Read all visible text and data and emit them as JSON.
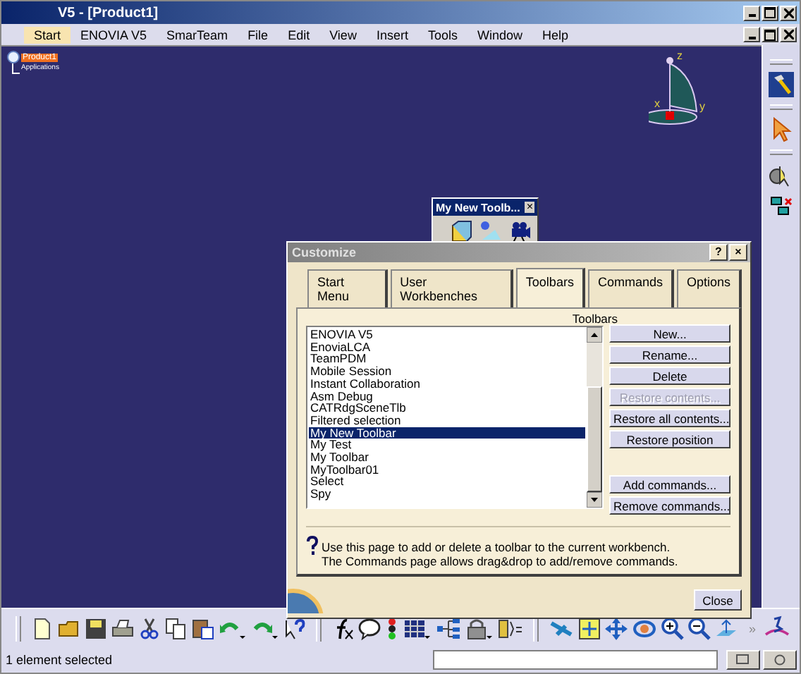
{
  "window": {
    "title": "V5 - [Product1]"
  },
  "menu": [
    {
      "label": "Start",
      "selected": true
    },
    {
      "label": "ENOVIA V5",
      "selected": false
    },
    {
      "label": "SmarTeam",
      "selected": false
    },
    {
      "label": "File",
      "selected": false
    },
    {
      "label": "Edit",
      "selected": false
    },
    {
      "label": "View",
      "selected": false
    },
    {
      "label": "Insert",
      "selected": false
    },
    {
      "label": "Tools",
      "selected": false
    },
    {
      "label": "Window",
      "selected": false
    },
    {
      "label": "Help",
      "selected": false
    }
  ],
  "tree": [
    {
      "label": "Product1",
      "selected": true,
      "children": [
        {
          "label": "Applications",
          "selected": false
        }
      ]
    }
  ],
  "compass": {
    "z_label": "z",
    "y_label": "y",
    "x_label": "x"
  },
  "floating_toolbar": {
    "title": "My New Toolb...",
    "close": "×"
  },
  "dialog": {
    "title": "Customize",
    "help_button": "?",
    "close_button": "×",
    "tabs": [
      {
        "label": "Start Menu",
        "selected": false
      },
      {
        "label": "User Workbenches",
        "selected": false
      },
      {
        "label": "Toolbars",
        "selected": true
      },
      {
        "label": "Commands",
        "selected": false
      },
      {
        "label": "Options",
        "selected": false
      }
    ],
    "list_label": "Toolbars",
    "toolbars": [
      {
        "label": "ENOVIA V5",
        "selected": false
      },
      {
        "label": "EnoviaLCA",
        "selected": false
      },
      {
        "label": "TeamPDM",
        "selected": false
      },
      {
        "label": "Mobile Session",
        "selected": false
      },
      {
        "label": "Instant Collaboration",
        "selected": false
      },
      {
        "label": "Asm Debug",
        "selected": false
      },
      {
        "label": "CATRdgSceneTlb",
        "selected": false
      },
      {
        "label": "Filtered selection",
        "selected": false
      },
      {
        "label": "My New Toolbar",
        "selected": true
      },
      {
        "label": "My Test",
        "selected": false
      },
      {
        "label": "My Toolbar",
        "selected": false
      },
      {
        "label": "MyToolbar01",
        "selected": false
      },
      {
        "label": "Select",
        "selected": false
      },
      {
        "label": "Spy",
        "selected": false
      }
    ],
    "buttons": [
      {
        "label": "New...",
        "disabled": false,
        "kind": "action"
      },
      {
        "label": "Rename...",
        "disabled": false,
        "kind": "action"
      },
      {
        "label": "Delete",
        "disabled": false,
        "kind": "action"
      },
      {
        "label": "Restore contents...",
        "disabled": true,
        "kind": "action"
      },
      {
        "label": "Restore all contents...",
        "disabled": false,
        "kind": "action"
      },
      {
        "label": "Restore position",
        "disabled": false,
        "kind": "action"
      },
      {
        "label": "Add commands...",
        "disabled": false,
        "kind": "command"
      },
      {
        "label": "Remove commands...",
        "disabled": false,
        "kind": "command"
      }
    ],
    "help_lines": [
      "Use this page to add or delete a toolbar to the current workbench.",
      "The Commands page allows drag&drop to add/remove commands."
    ],
    "close": "Close"
  },
  "toolbar_more": "»",
  "status_bar": {
    "message": "1 element selected"
  }
}
